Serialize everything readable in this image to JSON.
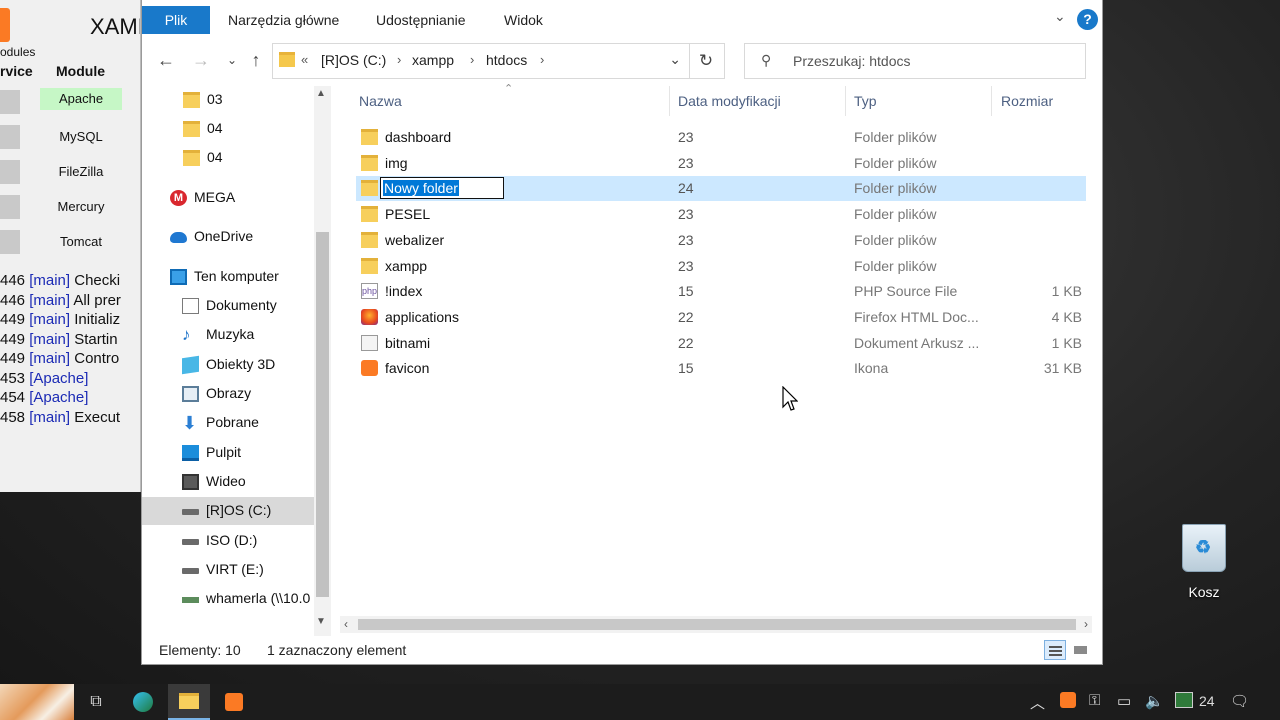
{
  "xampp": {
    "title": "XAMI",
    "modules_label": "odules",
    "service_header": "rvice",
    "module_header": "Module",
    "modules": [
      {
        "name": "Apache",
        "running": true
      },
      {
        "name": "MySQL",
        "running": false
      },
      {
        "name": "FileZilla",
        "running": false
      },
      {
        "name": "Mercury",
        "running": false
      },
      {
        "name": "Tomcat",
        "running": false
      }
    ],
    "log": [
      {
        "time": "446",
        "tag": "[main]",
        "msg": "Checki"
      },
      {
        "time": "446",
        "tag": "[main]",
        "msg": "All prer"
      },
      {
        "time": "449",
        "tag": "[main]",
        "msg": "Initializ"
      },
      {
        "time": "449",
        "tag": "[main]",
        "msg": "Startin"
      },
      {
        "time": "449",
        "tag": "[main]",
        "msg": "Contro"
      },
      {
        "time": "453",
        "tag": "[Apache]",
        "msg": ""
      },
      {
        "time": "454",
        "tag": "[Apache]",
        "msg": ""
      },
      {
        "time": "458",
        "tag": "[main]",
        "msg": "Execut"
      }
    ]
  },
  "ribbon": {
    "file_tab": "Plik",
    "tabs": [
      "Narzędzia główne",
      "Udostępnianie",
      "Widok"
    ],
    "help": "?"
  },
  "address": {
    "prefix": "«",
    "crumbs": [
      "[R]OS (C:)",
      "xampp",
      "htdocs"
    ],
    "separator": "›"
  },
  "search": {
    "placeholder": "Przeszukaj: htdocs"
  },
  "nav_pane": [
    {
      "label": "03",
      "icon": "folder-icon"
    },
    {
      "label": "04",
      "icon": "folder-icon"
    },
    {
      "label": "04",
      "icon": "folder-icon"
    },
    {
      "label": "MEGA",
      "icon": "mega-icon"
    },
    {
      "label": "OneDrive",
      "icon": "onedrive-icon"
    },
    {
      "label": "Ten komputer",
      "icon": "computer-icon"
    },
    {
      "label": "Dokumenty",
      "icon": "documents-icon"
    },
    {
      "label": "Muzyka",
      "icon": "music-icon"
    },
    {
      "label": "Obiekty 3D",
      "icon": "3d-objects-icon"
    },
    {
      "label": "Obrazy",
      "icon": "pictures-icon"
    },
    {
      "label": "Pobrane",
      "icon": "downloads-icon"
    },
    {
      "label": "Pulpit",
      "icon": "desktop-icon"
    },
    {
      "label": "Wideo",
      "icon": "video-icon"
    },
    {
      "label": "[R]OS (C:)",
      "icon": "drive-icon",
      "selected": true
    },
    {
      "label": "ISO (D:)",
      "icon": "drive-icon"
    },
    {
      "label": "VIRT (E:)",
      "icon": "drive-icon"
    },
    {
      "label": "whamerla (\\\\10.0",
      "icon": "network-drive-icon"
    }
  ],
  "columns": {
    "name": "Nazwa",
    "date": "Data modyfikacji",
    "type": "Typ",
    "size": "Rozmiar"
  },
  "files": [
    {
      "name": "dashboard",
      "date": "23",
      "type": "Folder plików",
      "size": "",
      "icon": "folder-icon"
    },
    {
      "name": "img",
      "date": "23",
      "type": "Folder plików",
      "size": "",
      "icon": "folder-icon"
    },
    {
      "name": "Nowy folder",
      "date": "24",
      "type": "Folder plików",
      "size": "",
      "icon": "folder-icon",
      "renaming": true
    },
    {
      "name": "PESEL",
      "date": "23",
      "type": "Folder plików",
      "size": "",
      "icon": "folder-icon"
    },
    {
      "name": "webalizer",
      "date": "23",
      "type": "Folder plików",
      "size": "",
      "icon": "folder-icon"
    },
    {
      "name": "xampp",
      "date": "23",
      "type": "Folder plików",
      "size": "",
      "icon": "folder-icon"
    },
    {
      "name": "!index",
      "date": "15",
      "type": "PHP Source File",
      "size": "1 KB",
      "icon": "php-file-icon"
    },
    {
      "name": "applications",
      "date": "22",
      "type": "Firefox HTML Doc...",
      "size": "4 KB",
      "icon": "firefox-html-icon"
    },
    {
      "name": "bitnami",
      "date": "22",
      "type": "Dokument Arkusz ...",
      "size": "1 KB",
      "icon": "stylesheet-file-icon"
    },
    {
      "name": "favicon",
      "date": "15",
      "type": "Ikona",
      "size": "31 KB",
      "icon": "xampp-icon"
    }
  ],
  "status": {
    "count": "Elementy: 10",
    "selection": "1 zaznaczony element"
  },
  "desktop": {
    "recycle_bin": "Kosz"
  },
  "taskbar": {
    "clock": "24"
  },
  "colors": {
    "accent": "#1979ca",
    "selection": "#cce8ff",
    "folder": "#f7cf5c",
    "xampp": "#fb7a24"
  }
}
